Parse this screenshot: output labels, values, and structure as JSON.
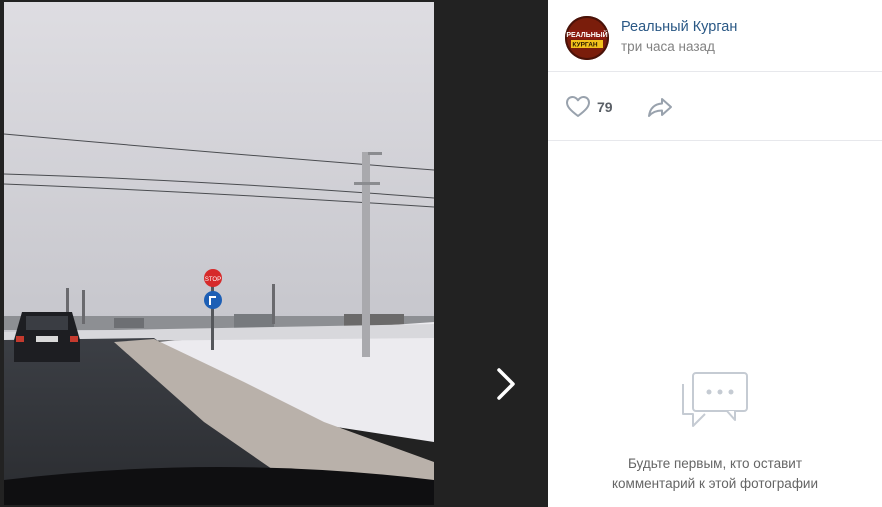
{
  "post": {
    "author_name": "Реальный Курган",
    "avatar_text_line1": "РЕАЛЬНЫЙ",
    "avatar_text_line2": "КУРГАН",
    "time": "три часа назад"
  },
  "actions": {
    "likes": "79",
    "like_icon": "heart-icon",
    "share_icon": "share-arrow-icon"
  },
  "comments": {
    "empty_line1": "Будьте первым, кто оставит",
    "empty_line2": "комментарий к этой фотографии",
    "icon": "comment-bubbles-icon"
  },
  "photo": {
    "sign_text": "STOP",
    "next_icon": "chevron-right-icon"
  },
  "colors": {
    "link": "#2a5885",
    "muted": "#828282",
    "divider": "#e7e8ec",
    "icon": "#99a2ad"
  }
}
